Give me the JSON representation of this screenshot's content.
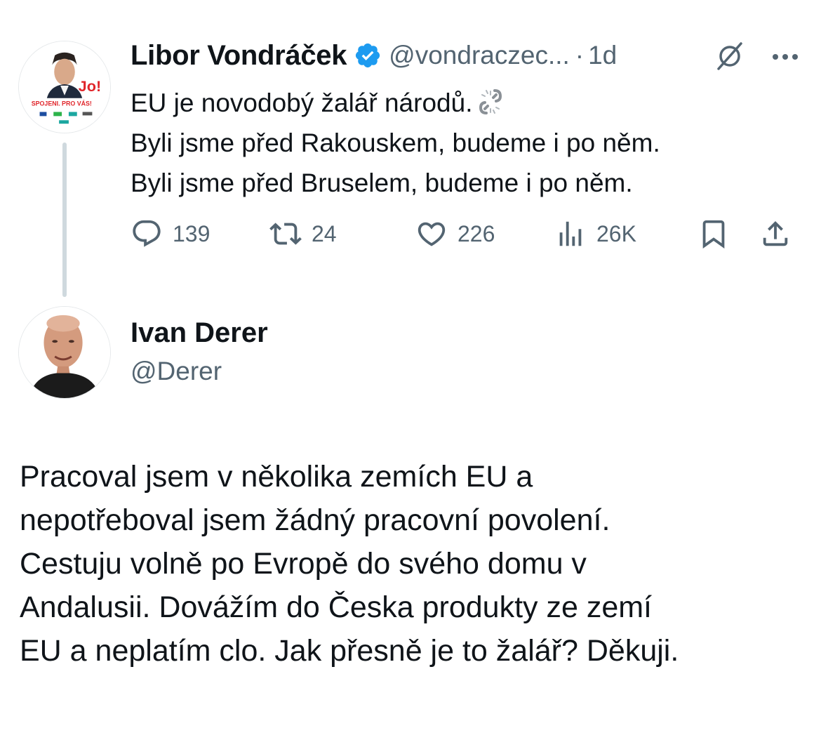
{
  "quoted_tweet": {
    "author_name": "Libor Vondráček",
    "handle": "@vondraczec...",
    "separator": "·",
    "time": "1d",
    "avatar_text": {
      "badge": "Jo!",
      "banner": "SPOJENI. PRO VÁS!"
    },
    "text_lines": [
      "EU je novodobý žalář národů.",
      "Byli jsme před Rakouskem, budeme i po něm.",
      "Byli jsme před Bruselem, budeme i po něm."
    ],
    "emoji": "broken-chain-icon",
    "stats": {
      "replies": "139",
      "retweets": "24",
      "likes": "226",
      "views": "26K"
    }
  },
  "reply": {
    "author_name": "Ivan Derer",
    "handle": "@Derer",
    "text_lines": [
      "Pracoval jsem v několika zemích EU a",
      "nepotřeboval jsem žádný pracovní povolení.",
      "Cestuju volně po Evropě do svého domu v",
      "Andalusii. Dovážím do Česka produkty ze zemí",
      "EU a neplatím clo. Jak přesně je to žalář? Děkuji."
    ]
  },
  "colors": {
    "text": "#0f1419",
    "secondary": "#536471",
    "verified": "#1d9bf0",
    "thread_line": "#cfd9de",
    "party_red": "#e0262b"
  }
}
